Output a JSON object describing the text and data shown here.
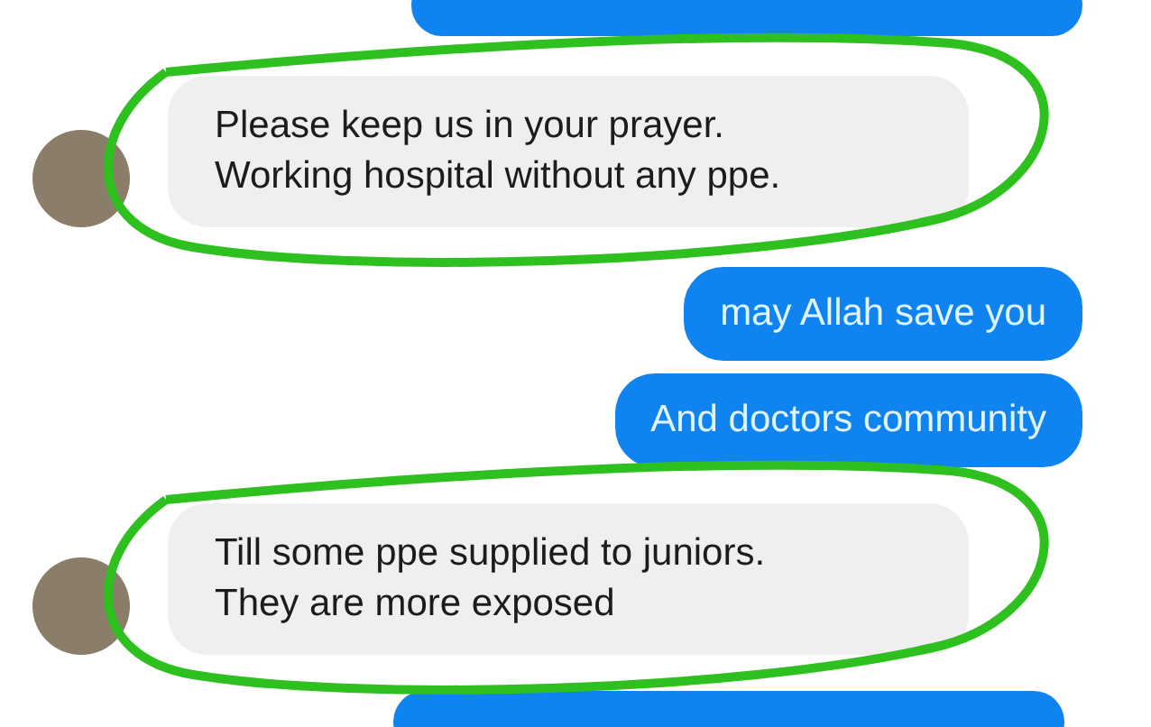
{
  "messages": [
    {
      "kind": "partial"
    },
    {
      "kind": "incoming",
      "text": "Please keep us in your prayer.\nWorking hospital without any ppe.",
      "circled": true
    },
    {
      "kind": "outgoing",
      "text": "may Allah save you"
    },
    {
      "kind": "outgoing",
      "text": "And doctors community"
    },
    {
      "kind": "incoming",
      "text": "Till some ppe supplied to juniors.\nThey are more exposed",
      "circled": true
    },
    {
      "kind": "partial"
    }
  ]
}
